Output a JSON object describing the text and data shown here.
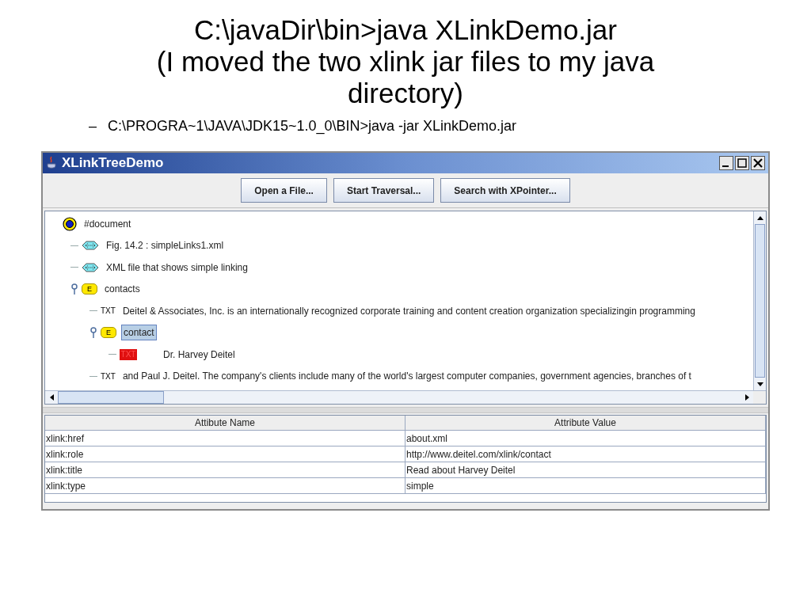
{
  "slide": {
    "title_lines": [
      "C:\\javaDir\\bin>java XLinkDemo.jar",
      "(I moved the two xlink jar files to my java directory)"
    ],
    "bullet": {
      "marker": "–",
      "text": "C:\\PROGRA~1\\JAVA\\JDK15~1.0_0\\BIN>java -jar XLinkDemo.jar"
    }
  },
  "window": {
    "title": "XLinkTreeDemo",
    "buttons": [
      "Open a File...",
      "Start Traversal...",
      "Search with XPointer..."
    ],
    "tree": [
      {
        "kind": "document",
        "label": "#document",
        "selected": false,
        "children": [
          {
            "kind": "link",
            "label": "Fig. 14.2 : simpleLinks1.xml",
            "selected": false
          },
          {
            "kind": "link",
            "label": "XML file that shows simple linking",
            "selected": false
          },
          {
            "kind": "element",
            "badge": "E",
            "label": "contacts",
            "selected": false,
            "expanded": true,
            "children": [
              {
                "kind": "text",
                "badge": "TXT",
                "label": "Deitel & Associates, Inc. is an internationally recognized corporate training and content creation organization specializingin programming",
                "selected": false,
                "highlighted": false
              },
              {
                "kind": "element",
                "badge": "E",
                "label": "contact",
                "selected": true,
                "expanded": true,
                "children": [
                  {
                    "kind": "text",
                    "badge": "TXT",
                    "label": "Dr. Harvey Deitel",
                    "selected": false,
                    "highlighted": true
                  }
                ]
              },
              {
                "kind": "text",
                "badge": "TXT",
                "label": "and Paul J. Deitel. The company's clients include many of the world's largest computer companies, government agencies, branches of t",
                "selected": false,
                "highlighted": false
              }
            ]
          }
        ]
      }
    ],
    "table": {
      "columns": [
        "Attibute Name",
        "Attribute Value"
      ],
      "rows": [
        [
          "xlink:href",
          "about.xml"
        ],
        [
          "xlink:role",
          "http://www.deitel.com/xlink/contact"
        ],
        [
          "xlink:title",
          "Read about Harvey Deitel"
        ],
        [
          "xlink:type",
          "simple"
        ]
      ]
    }
  }
}
